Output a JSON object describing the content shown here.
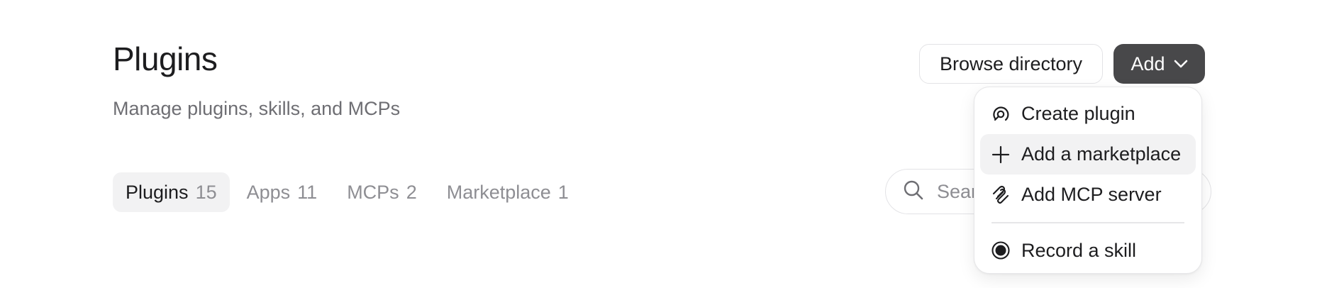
{
  "header": {
    "title": "Plugins",
    "subtitle": "Manage plugins, skills, and MCPs",
    "browse_label": "Browse directory",
    "add_label": "Add"
  },
  "tabs": [
    {
      "label": "Plugins",
      "count": "15",
      "active": true
    },
    {
      "label": "Apps",
      "count": "11",
      "active": false
    },
    {
      "label": "MCPs",
      "count": "2",
      "active": false
    },
    {
      "label": "Marketplace",
      "count": "1",
      "active": false
    }
  ],
  "search": {
    "placeholder": "Search",
    "icon": "search-icon"
  },
  "add_menu": {
    "items": [
      {
        "label": "Create plugin",
        "icon": "plugin-icon"
      },
      {
        "label": "Add a marketplace",
        "icon": "plus-icon",
        "highlighted": true
      },
      {
        "label": "Add MCP server",
        "icon": "mcp-icon"
      },
      {
        "label": "Record a skill",
        "icon": "record-icon"
      }
    ]
  },
  "colors": {
    "add_button_bg": "#48484a",
    "active_tab_bg": "#f2f2f3",
    "muted_text": "#8e8e93"
  }
}
